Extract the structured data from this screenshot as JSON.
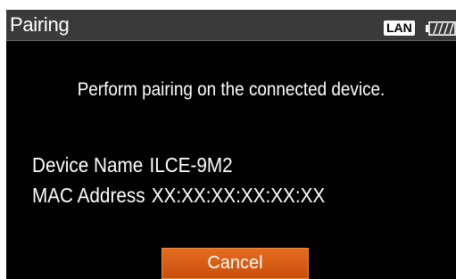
{
  "header": {
    "title": "Pairing",
    "lan_label": "LAN",
    "battery_icon": "battery-icon"
  },
  "main": {
    "message": "Perform pairing on the connected device.",
    "device_name_label": "Device Name",
    "device_name_value": "ILCE-9M2",
    "mac_address_label": "MAC Address",
    "mac_address_value": "XX:XX:XX:XX:XX:XX"
  },
  "actions": {
    "cancel_label": "Cancel"
  },
  "colors": {
    "background": "#000000",
    "title_bar": "#3a3a3a",
    "cancel_button": "#d95f12",
    "text": "#ffffff"
  }
}
